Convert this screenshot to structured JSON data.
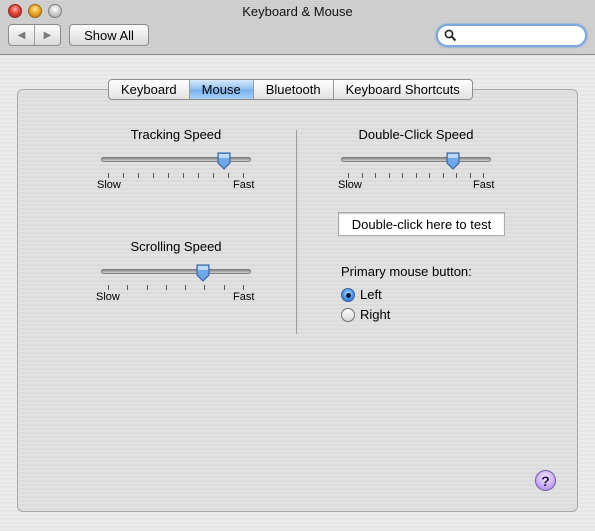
{
  "window": {
    "title": "Keyboard & Mouse"
  },
  "toolbar": {
    "back_icon": "◀",
    "forward_icon": "▶",
    "show_all_label": "Show All",
    "search_value": ""
  },
  "tabs": [
    {
      "label": "Keyboard",
      "active": false
    },
    {
      "label": "Mouse",
      "active": true
    },
    {
      "label": "Bluetooth",
      "active": false
    },
    {
      "label": "Keyboard Shortcuts",
      "active": false
    }
  ],
  "tracking": {
    "title": "Tracking Speed",
    "min_label": "Slow",
    "max_label": "Fast",
    "tick_count": 10,
    "value": 0.85
  },
  "scrolling": {
    "title": "Scrolling Speed",
    "min_label": "Slow",
    "max_label": "Fast",
    "tick_count": 8,
    "value": 0.7
  },
  "double_click": {
    "title": "Double-Click Speed",
    "min_label": "Slow",
    "max_label": "Fast",
    "tick_count": 11,
    "value": 0.77,
    "test_text": "Double-click here to test"
  },
  "primary_button": {
    "label": "Primary mouse button:",
    "options": [
      {
        "label": "Left",
        "selected": true
      },
      {
        "label": "Right",
        "selected": false
      }
    ]
  },
  "help": {
    "label": "?"
  },
  "colors": {
    "accent": "#78b0ec",
    "focus_ring": "#7ea9dc"
  }
}
